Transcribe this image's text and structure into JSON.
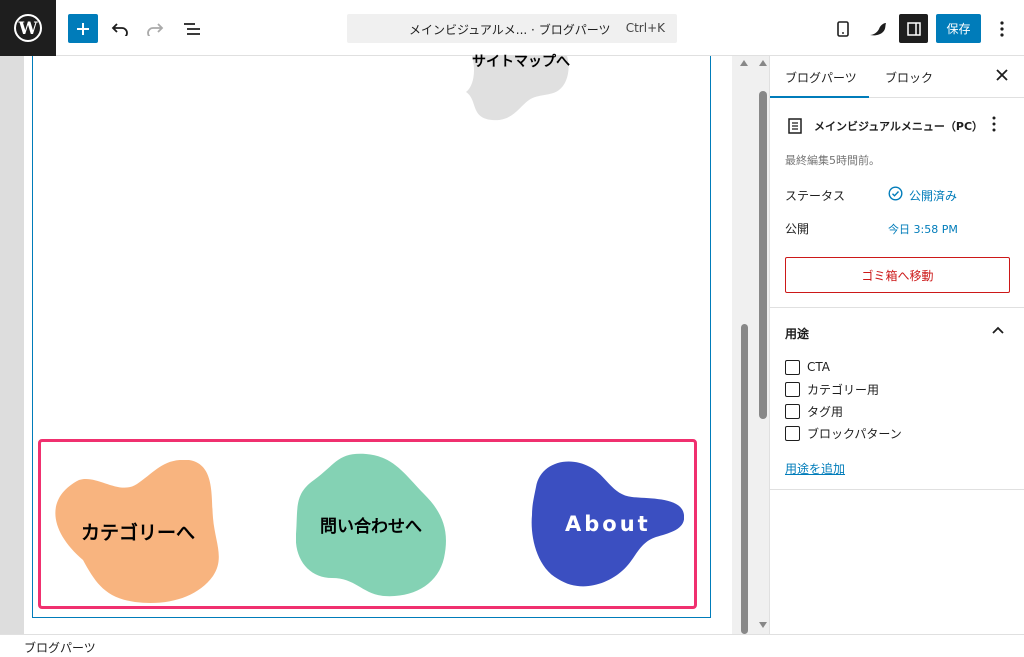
{
  "topbar": {
    "document_title": "メインビジュアルメ... · ブログパーツ",
    "shortcut": "Ctrl+K",
    "save_label": "保存"
  },
  "canvas": {
    "blobs": [
      {
        "label": "サイトマップへ",
        "color": "#e0e0e0"
      },
      {
        "label": "カテゴリーへ",
        "color": "#f8b47f"
      },
      {
        "label": "問い合わせへ",
        "color": "#84d2b4"
      },
      {
        "label": "About",
        "color": "#3b4fc1"
      }
    ]
  },
  "statusbar": {
    "breadcrumb": "ブログパーツ"
  },
  "sidebar": {
    "tabs": [
      "ブログパーツ",
      "ブロック"
    ],
    "post_title": "メインビジュアルメニュー（PC）",
    "last_edited": "最終編集5時間前。",
    "status_label": "ステータス",
    "status_value": "公開済み",
    "publish_label": "公開",
    "publish_value": "今日 3:58 PM",
    "trash_label": "ゴミ箱へ移動",
    "usage_heading": "用途",
    "usage_options": [
      "CTA",
      "カテゴリー用",
      "タグ用",
      "ブロックパターン"
    ],
    "add_usage": "用途を追加"
  }
}
